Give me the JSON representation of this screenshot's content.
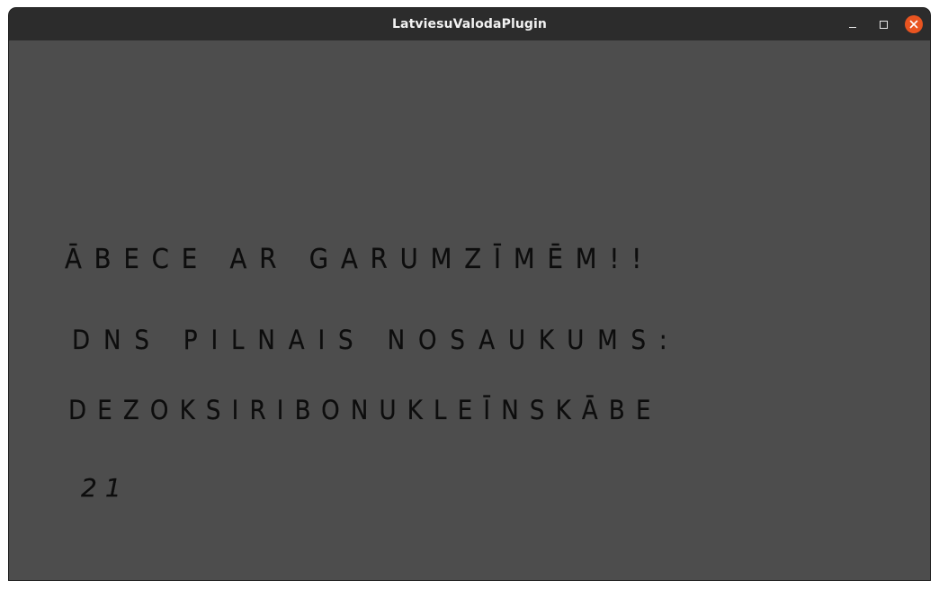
{
  "window": {
    "title": "LatviesuValodaPlugin",
    "controls": {
      "minimize_icon": "minimize-icon",
      "maximize_icon": "maximize-icon",
      "close_icon": "close-icon",
      "close_glyph": "✕"
    },
    "colors": {
      "titlebar": "#2c2c2c",
      "content_background": "#4d4d4d",
      "close_button": "#e95420",
      "handwriting": "#0d0d0d"
    }
  },
  "canvas": {
    "lines": [
      "ĀBECE AR GARUMZĪMĒM!!",
      "DNS PILNAIS NOSAUKUMS:",
      "DEZOKSIRIBONUKLEĪNSKĀBE",
      "21"
    ]
  }
}
